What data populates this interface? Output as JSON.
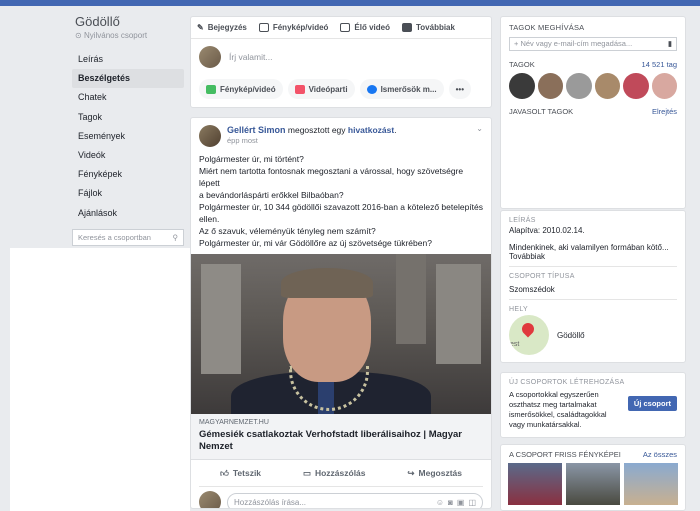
{
  "group": {
    "name": "Gödöllő",
    "privacy": "Nyilvános csoport"
  },
  "nav": [
    "Leírás",
    "Beszélgetés",
    "Chatek",
    "Tagok",
    "Események",
    "Videók",
    "Fényképek",
    "Fájlok",
    "Ajánlások"
  ],
  "nav_active": 1,
  "search": {
    "placeholder": "Keresés a csoportban"
  },
  "composer": {
    "tabs": [
      "Bejegyzés",
      "Fénykép/videó",
      "Élő videó",
      "Továbbiak"
    ],
    "placeholder": "Írj valamit...",
    "buttons": [
      "Fénykép/videó",
      "Videóparti",
      "Ismerősök m..."
    ],
    "more": "•••"
  },
  "post": {
    "author": "Gellért Simon",
    "shared_text": "megosztott egy",
    "shared_link": "hivatkozást",
    "time": "épp most",
    "lines": [
      "Polgármester úr, mi történt?",
      "Miért nem tartotta fontosnak megosztani a várossal, hogy szövetségre lépett",
      "a bevándorláspárti erőkkel Bilbaóban?",
      "Polgármester úr, 10 344 gödöllői szavazott 2016-ban a kötelező betelepítés",
      "ellen.",
      "Az ő szavuk, véleményük tényleg nem számít?",
      "Polgármester úr, mi vár Gödöllőre az új szövetsége tükrében?"
    ],
    "link_domain": "MAGYARNEMZET.HU",
    "link_title": "Gémesiék csatlakoztak Verhofstadt liberálisaihoz | Magyar Nemzet",
    "actions": [
      "Tetszik",
      "Hozzászólás",
      "Megosztás"
    ],
    "comment_placeholder": "Hozzászólás írása..."
  },
  "right": {
    "invite_title": "TAGOK MEGHÍVÁSA",
    "invite_placeholder": "+ Név vagy e-mail-cím megadása...",
    "members_label": "TAGOK",
    "members_count": "14 521 tag",
    "suggested": "JAVASOLT TAGOK",
    "suggested_link": "Elrejtés",
    "about_label": "LEÍRÁS",
    "founded": "Alapítva: 2010.02.14.",
    "description": "Mindenkinek, aki valamilyen formában kötő...",
    "more": "Továbbiak",
    "type_label": "CSOPORT TÍPUSA",
    "type": "Szomszédok",
    "place_label": "HELY",
    "place": "Gödöllő",
    "map_text": "est",
    "new_group_label": "ÚJ CSOPORTOK LÉTREHOZÁSA",
    "new_group_text": "A csoportokkal egyszerűen oszthatsz meg tartalmakat ismerősökkel, családtagokkal vagy munkatársakkal.",
    "new_group_button": "Új csoport",
    "photos_label": "A CSOPORT FRISS FÉNYKÉPEI",
    "photos_link": "Az összes"
  }
}
